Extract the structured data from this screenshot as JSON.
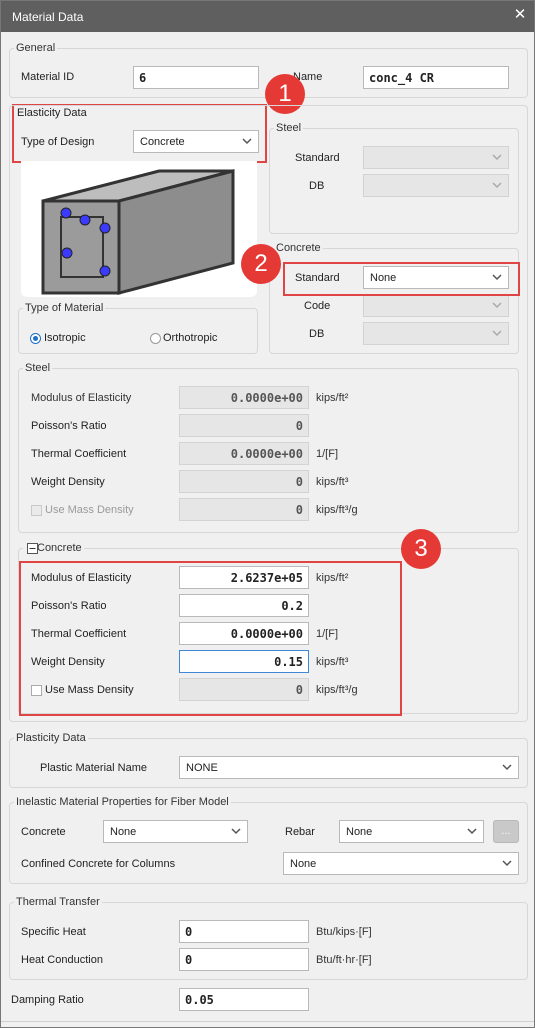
{
  "window": {
    "title": "Material Data"
  },
  "general": {
    "legend": "General",
    "material_id_label": "Material ID",
    "material_id_value": "6",
    "name_label": "Name",
    "name_value": "conc_4 CR"
  },
  "elasticity": {
    "legend": "Elasticity Data",
    "type_of_design_label": "Type of Design",
    "type_of_design_value": "Concrete"
  },
  "steel_top": {
    "legend": "Steel",
    "standard_label": "Standard",
    "db_label": "DB"
  },
  "concrete_top": {
    "legend": "Concrete",
    "standard_label": "Standard",
    "standard_value": "None",
    "code_label": "Code",
    "db_label": "DB"
  },
  "type_of_material": {
    "legend": "Type of Material",
    "isotropic": "Isotropic",
    "orthotropic": "Orthotropic"
  },
  "steel_props": {
    "legend": "Steel",
    "rows": [
      {
        "label": "Modulus of Elasticity",
        "value": "0.0000e+00",
        "unit": "kips/ft²"
      },
      {
        "label": "Poisson's Ratio",
        "value": "0",
        "unit": ""
      },
      {
        "label": "Thermal Coefficient",
        "value": "0.0000e+00",
        "unit": "1/[F]"
      },
      {
        "label": "Weight Density",
        "value": "0",
        "unit": "kips/ft³"
      },
      {
        "label": "Use Mass Density",
        "value": "0",
        "unit": "kips/ft³/g"
      }
    ]
  },
  "concrete_props": {
    "legend": "Concrete",
    "rows": [
      {
        "label": "Modulus of Elasticity",
        "value": "2.6237e+05",
        "unit": "kips/ft²"
      },
      {
        "label": "Poisson's Ratio",
        "value": "0.2",
        "unit": ""
      },
      {
        "label": "Thermal Coefficient",
        "value": "0.0000e+00",
        "unit": "1/[F]"
      },
      {
        "label": "Weight Density",
        "value": "0.15",
        "unit": "kips/ft³"
      },
      {
        "label": "Use Mass Density",
        "value": "0",
        "unit": "kips/ft³/g"
      }
    ]
  },
  "plasticity": {
    "legend": "Plasticity Data",
    "plastic_material_label": "Plastic Material Name",
    "plastic_material_value": "NONE"
  },
  "inelastic": {
    "legend": "Inelastic Material Properties for Fiber Model",
    "concrete_label": "Concrete",
    "concrete_value": "None",
    "rebar_label": "Rebar",
    "rebar_value": "None",
    "dots_label": "...",
    "confined_label": "Confined Concrete for Columns",
    "confined_value": "None"
  },
  "thermal": {
    "legend": "Thermal Transfer",
    "specific_heat_label": "Specific Heat",
    "specific_heat_value": "0",
    "specific_heat_unit": "Btu/kips·[F]",
    "heat_conduction_label": "Heat Conduction",
    "heat_conduction_value": "0",
    "heat_conduction_unit": "Btu/ft·hr·[F]"
  },
  "damping": {
    "label": "Damping Ratio",
    "value": "0.05"
  },
  "badges": [
    "1",
    "2",
    "3"
  ],
  "colors": {
    "annotation_red": "#e04545",
    "badge_red": "#e53935",
    "titlebar": "#5f5f5f",
    "focus_blue": "#3d89d6"
  }
}
